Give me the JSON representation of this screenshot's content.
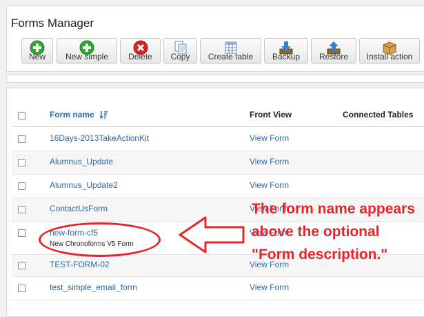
{
  "page": {
    "title": "Forms Manager"
  },
  "toolbar": {
    "buttons": [
      {
        "id": "new",
        "label": "New",
        "icon": "plus-icon"
      },
      {
        "id": "new-simple",
        "label": "New simple",
        "icon": "plus-icon"
      },
      {
        "id": "delete",
        "label": "Delete",
        "icon": "delete-icon"
      },
      {
        "id": "copy",
        "label": "Copy",
        "icon": "copy-icon"
      },
      {
        "id": "create-table",
        "label": "Create table",
        "icon": "table-icon"
      },
      {
        "id": "backup",
        "label": "Backup",
        "icon": "download-icon"
      },
      {
        "id": "restore",
        "label": "Restore",
        "icon": "upload-icon"
      },
      {
        "id": "install-action",
        "label": "Install action",
        "icon": "package-icon"
      }
    ]
  },
  "table": {
    "columns": {
      "name": "Form name",
      "front": "Front View",
      "connected": "Connected Tables"
    },
    "rows": [
      {
        "name": "16Days-2013TakeActionKit",
        "view": "View Form",
        "description": ""
      },
      {
        "name": "Alumnus_Update",
        "view": "View Form",
        "description": ""
      },
      {
        "name": "Alumnus_Update2",
        "view": "View Form",
        "description": ""
      },
      {
        "name": "ContactUsForm",
        "view": "View Form",
        "description": ""
      },
      {
        "name": "new-form-cf5",
        "view": "View Form",
        "description": "New Chronoforms V5 Form"
      },
      {
        "name": "TEST-FORM-02",
        "view": "View Form",
        "description": ""
      },
      {
        "name": "test_simple_email_form",
        "view": "View Form",
        "description": ""
      }
    ]
  },
  "annotation": {
    "text": "The form name appears above the optional \"Form description.\""
  },
  "colors": {
    "link": "#2c6aa6",
    "annotation": "#e3262a",
    "add_green": "#2fa82f",
    "delete_red": "#d9231f"
  }
}
